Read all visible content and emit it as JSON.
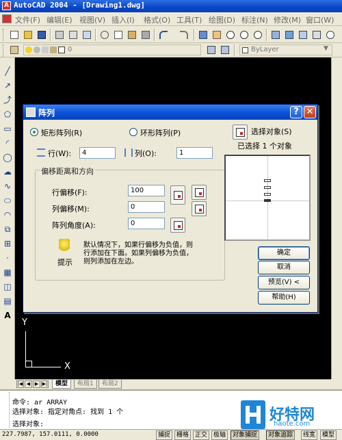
{
  "app": {
    "title": "AutoCAD 2004 - [Drawing1.dwg]"
  },
  "menu": [
    "文件(F)",
    "编辑(E)",
    "视图(V)",
    "插入(I)",
    "格式(O)",
    "工具(T)",
    "绘图(D)",
    "标注(N)",
    "修改(M)",
    "窗口(W)"
  ],
  "layer_toolbar": {
    "layer_value": "0",
    "color_value": "ByLayer"
  },
  "dialog": {
    "title": "阵列",
    "radio_rect": "矩形阵列(R)",
    "radio_polar": "环形阵列(P)",
    "select_objects_label": "选择对象(S)",
    "selected_count_text": "已选择 1 个对象",
    "rows_label": "行(W):",
    "rows_value": "4",
    "cols_label": "列(O):",
    "cols_value": "1",
    "offset_group_title": "偏移距离和方向",
    "row_offset_label": "行偏移(F):",
    "row_offset_value": "100",
    "col_offset_label": "列偏移(M):",
    "col_offset_value": "0",
    "angle_label": "阵列角度(A):",
    "angle_value": "0",
    "tip_label": "提示",
    "tip_text_1": "默认情况下，如果行偏移为负值，则",
    "tip_text_2": "行添加在下面。如果列偏移为负值，",
    "tip_text_3": "则列添加在左边。",
    "ok_label": "确定",
    "cancel_label": "取消",
    "preview_label": "预览(V) <",
    "help_label": "帮助(H)"
  },
  "ucs": {
    "x_label": "X",
    "y_label": "Y"
  },
  "tabs": [
    "模型",
    "布局1",
    "布局2"
  ],
  "command": {
    "line1": "命令: ar ARRAY",
    "line2": "选择对象: 指定对角点: 找到 1 个",
    "line3": "选择对象:"
  },
  "status": {
    "coords": "227.7987, 157.0111, 0.0000",
    "buttons": [
      "捕捉",
      "栅格",
      "正交",
      "极轴",
      "对象捕捉",
      "对象追踪",
      "线宽",
      "模型"
    ]
  },
  "watermark": {
    "text": "好特网",
    "url": "haote.com"
  }
}
